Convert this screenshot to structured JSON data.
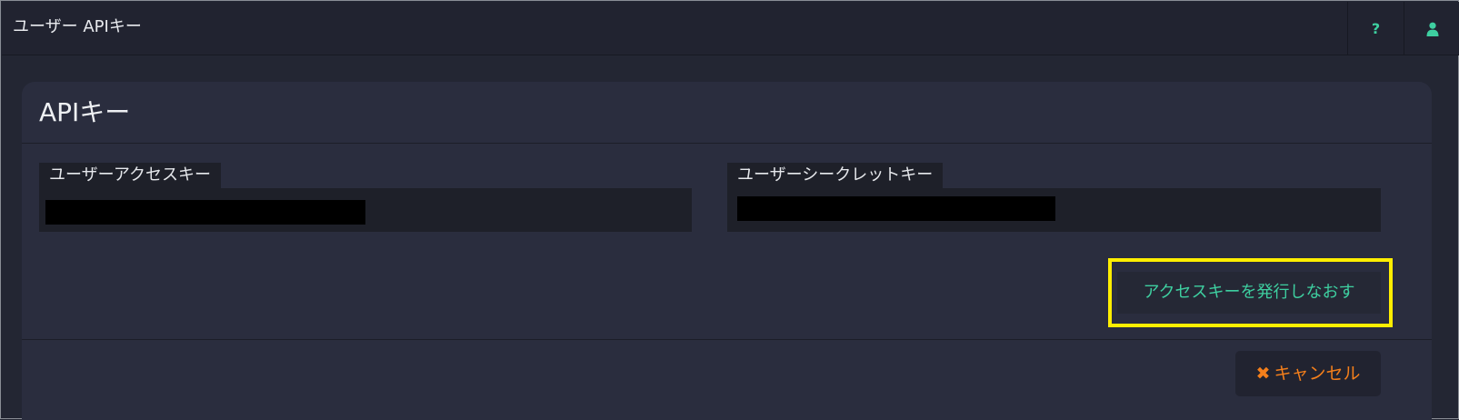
{
  "header": {
    "title": "ユーザー APIキー",
    "help_glyph": "?",
    "icons": [
      "help-icon",
      "user-icon"
    ],
    "accent_color": "#3ecfa0"
  },
  "panel": {
    "title": "APIキー"
  },
  "fields": {
    "access_key_label": "ユーザーアクセスキー",
    "secret_key_label": "ユーザーシークレットキー"
  },
  "actions": {
    "reissue_label": "アクセスキーを発行しなおす",
    "cancel_glyph": "✖",
    "cancel_label": "キャンセル",
    "cancel_color": "#f47f1b",
    "highlight_color": "#ffee00"
  }
}
